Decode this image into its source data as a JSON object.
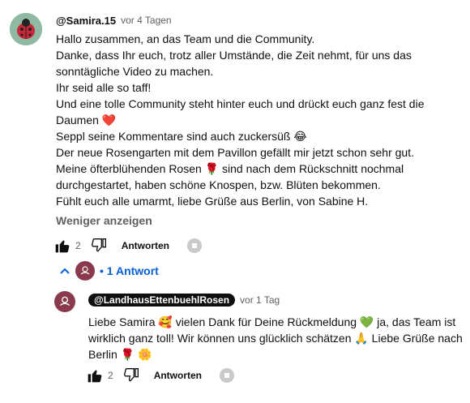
{
  "comment": {
    "author": "@Samira.15",
    "time": "vor 4 Tagen",
    "lines": [
      "Hallo zusammen, an  das Team und die Community.",
      "Danke, dass Ihr euch, trotz aller Umstände,  die Zeit nehmt, für uns das",
      "sonntägliche Video zu machen.",
      "Ihr seid alle so taff!",
      "Und eine tolle Community steht hinter euch und drückt euch ganz fest die",
      "Daumen ❤️",
      "Seppl seine Kommentare sind auch zuckersüß 😂",
      "Der neue Rosengarten mit dem Pavillon gefällt mir jetzt schon sehr gut.",
      "Meine öfterblühenden Rosen 🌹  sind nach dem Rückschnitt nochmal",
      "durchgestartet, haben schöne Knospen, bzw. Blüten bekommen.",
      "Fühlt euch alle umarmt, liebe Grüße aus Berlin,  von Sabine H."
    ],
    "show_less": "Weniger anzeigen",
    "like_count": "2",
    "reply_label": "Antworten"
  },
  "replies_toggle": {
    "label": "1 Antwort"
  },
  "reply": {
    "author": "@LandhausEttenbuehlRosen",
    "time": "vor 1 Tag",
    "lines": [
      "Liebe Samira 🥰  vielen Dank für Deine Rückmeldung  💚  ja, das Team ist",
      "wirklich ganz toll! Wir können uns glücklich schätzen 🙏 Liebe Grüße nach",
      "Berlin 🌹 🌼"
    ],
    "like_count": "2",
    "reply_label": "Antworten"
  }
}
